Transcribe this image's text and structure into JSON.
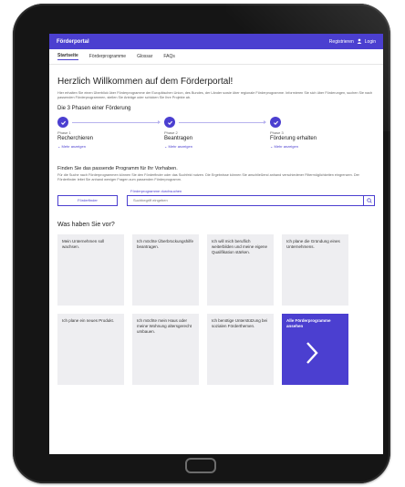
{
  "header": {
    "brand": "Förderportal",
    "actions": "Registrieren",
    "login": "Login"
  },
  "nav": {
    "items": [
      "Startseite",
      "Förderprogramme",
      "Glossar",
      "FAQs"
    ]
  },
  "main": {
    "title": "Herzlich Willkommen auf dem Förderportal!",
    "intro": "Hier erhalten Sie einen Überblick über Förderprogramme der Europäischen Union, des Bundes, der Länder sowie über regionale Förderprogramme. Informieren Sie sich über Förderungen, suchen Sie nach passenden Förderprogrammen, stellen Sie Anträge oder schicken Sie Ihre Projekte ab.",
    "phases_title": "Die 3 Phasen einer Förderung",
    "phases": [
      {
        "num": "Phase 1",
        "name": "Recherchieren",
        "more": "Mehr anzeigen"
      },
      {
        "num": "Phase 2",
        "name": "Beantragen",
        "more": "Mehr anzeigen"
      },
      {
        "num": "Phase 3",
        "name": "Förderung erhalten",
        "more": "Mehr anzeigen"
      }
    ],
    "find_title": "Finden Sie das passende Programm für Ihr Vorhaben.",
    "find_text": "Für die Suche nach Förderprogrammen können Sie den Förderfinder oder das Suchfeld nutzen. Die Ergebnisse können Sie anschließend anhand verschiedener Filtermöglichkeiten eingrenzen. Der Förderfinder leitet Sie anhand weniger Fragen zum passenden Förderprogramm.",
    "search_label": "Förderprogramme durchsuchen",
    "finder_button": "Förderfinder",
    "search_placeholder": "Suchbegriff eingeben",
    "section_title": "Was haben Sie vor?",
    "cards": [
      "Mein Unternehmen soll wachsen.",
      "Ich möchte Überbrückungshilfe beantragen.",
      "Ich will mich beruflich weiterbilden und meine eigene Qualifikation stärken.",
      "Ich plane die Gründung eines Unternehmens.",
      "Ich plane ein neues Produkt.",
      "Ich möchte mein Haus oder meine Wohnung altersgerecht umbauen.",
      "Ich benötige Unterstützung bei sozialen Förderthemen."
    ],
    "cta": "Alle Förderprogramme ansehen"
  },
  "colors": {
    "accent": "#4b3fd0",
    "card_bg": "#eeeef1",
    "bezel": "#151515"
  },
  "icons": [
    "check-icon",
    "chevron-down-icon",
    "search-icon",
    "user-icon",
    "chevron-right-icon"
  ]
}
